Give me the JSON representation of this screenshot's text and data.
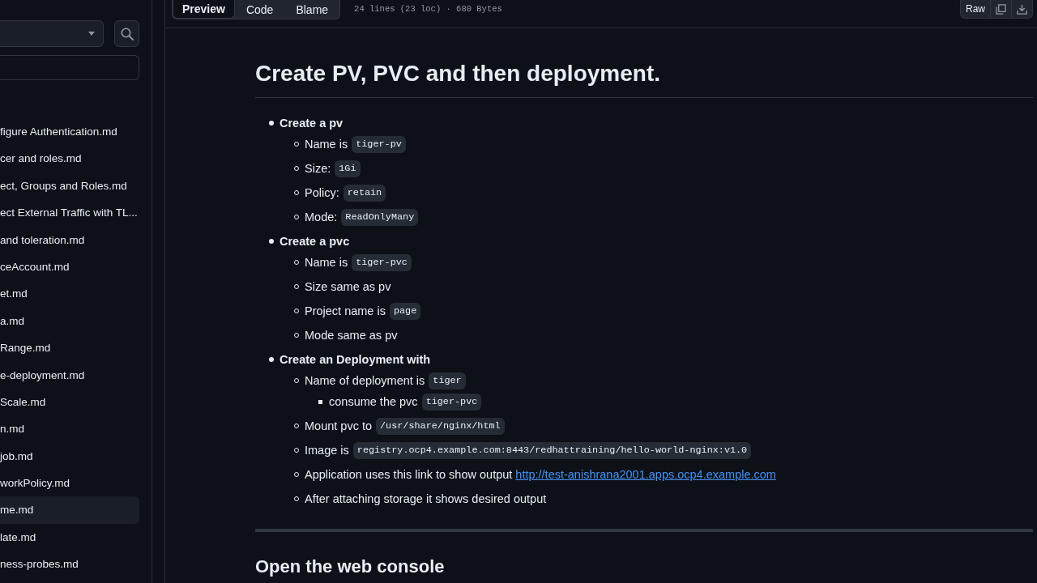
{
  "sidebar": {
    "files": [
      {
        "name": "figure Authentication.md",
        "selected": false
      },
      {
        "name": "cer and roles.md",
        "selected": false
      },
      {
        "name": "ect, Groups and Roles.md",
        "selected": false
      },
      {
        "name": "ect External Traffic with TL...",
        "selected": false
      },
      {
        "name": "and toleration.md",
        "selected": false
      },
      {
        "name": "ceAccount.md",
        "selected": false
      },
      {
        "name": "et.md",
        "selected": false
      },
      {
        "name": "a.md",
        "selected": false
      },
      {
        "name": "Range.md",
        "selected": false
      },
      {
        "name": "e-deployment.md",
        "selected": false
      },
      {
        "name": "Scale.md",
        "selected": false
      },
      {
        "name": "n.md",
        "selected": false
      },
      {
        "name": "job.md",
        "selected": false
      },
      {
        "name": "workPolicy.md",
        "selected": false
      },
      {
        "name": "me.md",
        "selected": true
      },
      {
        "name": "late.md",
        "selected": false
      },
      {
        "name": "ness-probes.md",
        "selected": false
      }
    ]
  },
  "file_header": {
    "tabs": [
      {
        "label": "Preview",
        "selected": true
      },
      {
        "label": "Code",
        "selected": false
      },
      {
        "label": "Blame",
        "selected": false
      }
    ],
    "info": "24 lines (23 loc) · 680 Bytes",
    "raw_label": "Raw"
  },
  "document": {
    "title": "Create PV, PVC and then deployment.",
    "items": [
      {
        "text": "Create a pv",
        "children": [
          {
            "text": "Name is",
            "code": "tiger-pv"
          },
          {
            "text": "Size:",
            "code": "1Gi"
          },
          {
            "text": "Policy:",
            "code": "retain"
          },
          {
            "text": "Mode:",
            "code": "ReadOnlyMany"
          }
        ]
      },
      {
        "text": "Create a pvc",
        "children": [
          {
            "text": "Name is",
            "code": "tiger-pvc"
          },
          {
            "text": "Size same as pv"
          },
          {
            "text": "Project name is",
            "code": "page"
          },
          {
            "text": "Mode same as pv"
          }
        ]
      },
      {
        "text": "Create an Deployment with",
        "children": [
          {
            "text": "Name of deployment is",
            "code": "tiger",
            "children": [
              {
                "text": "consume the pvc",
                "code": "tiger-pvc"
              }
            ]
          },
          {
            "text": "Mount pvc to",
            "code": "/usr/share/nginx/html"
          },
          {
            "text": "Image is",
            "code": "registry.ocp4.example.com:8443/redhattraining/hello-world-nginx:v1.0"
          },
          {
            "text": "Application uses this link to show output",
            "link": "http://test-anishrana2001.apps.ocp4.example.com"
          },
          {
            "text": "After attaching storage it shows desired output"
          }
        ]
      }
    ],
    "next_heading": "Open the web console"
  }
}
